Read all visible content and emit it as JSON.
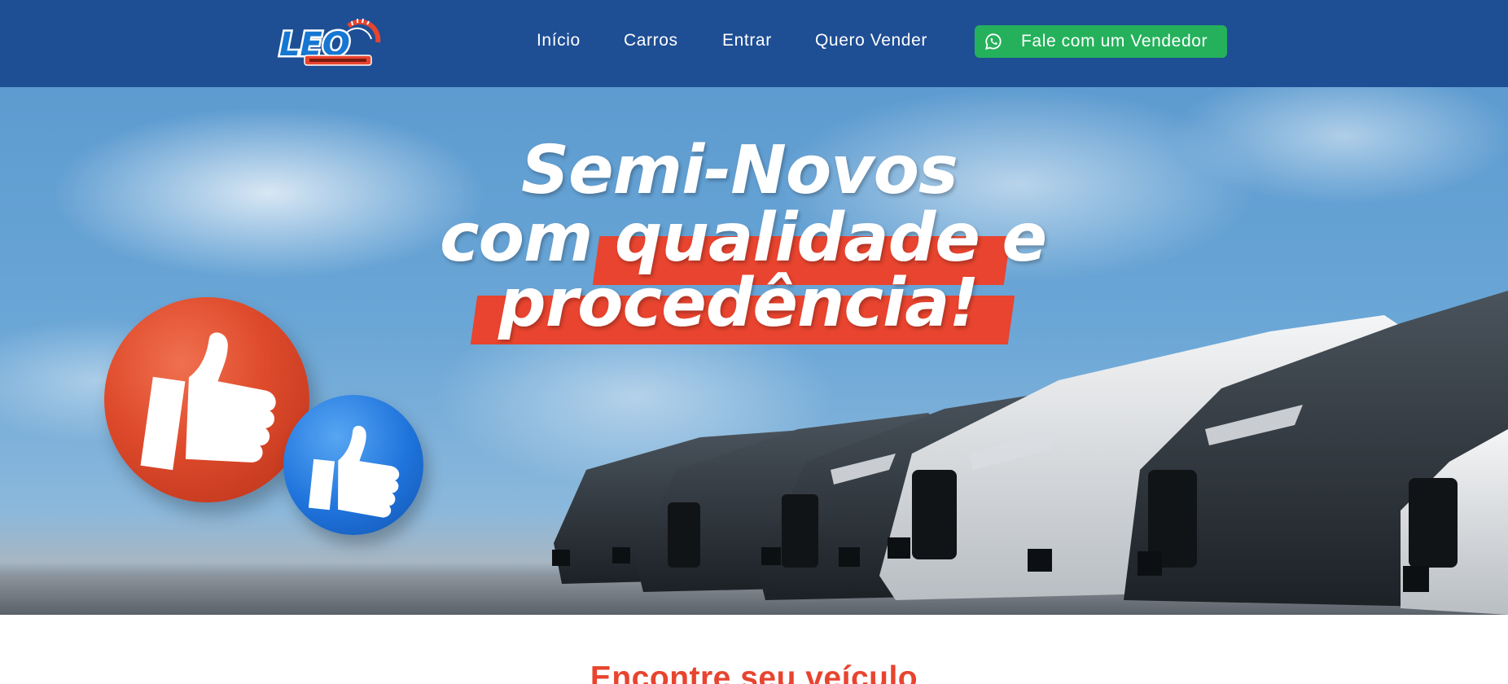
{
  "header": {
    "logo_alt": "LEO",
    "nav": {
      "inicio": "Início",
      "carros": "Carros",
      "entrar": "Entrar",
      "quero_vender": "Quero Vender"
    },
    "cta": {
      "label": "Fale com um Vendedor",
      "icon": "whatsapp-icon"
    }
  },
  "hero": {
    "headline_line1": "Semi-Novos",
    "headline_line2": "com qualidade e",
    "headline_line3": "procedência!"
  },
  "section": {
    "title": "Encontre seu veículo"
  },
  "colors": {
    "header_bg": "#1e4e94",
    "cta_bg": "#25b15c",
    "accent_red": "#e8442f",
    "thumb_blue": "#1f74dc"
  }
}
